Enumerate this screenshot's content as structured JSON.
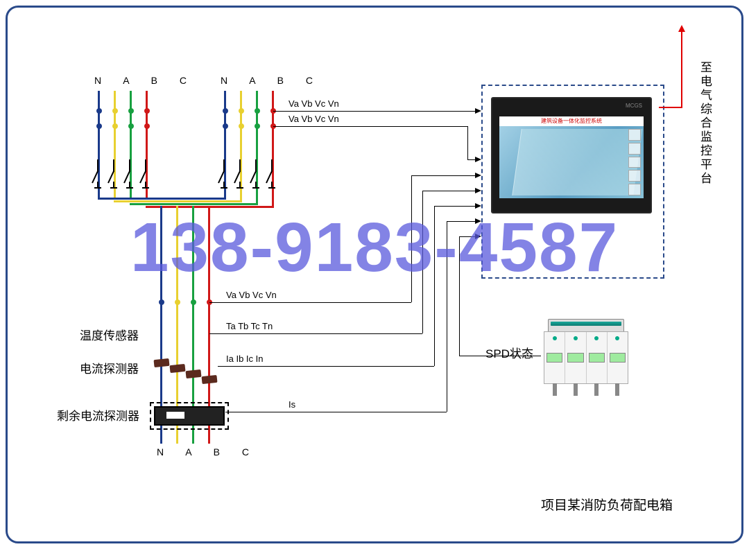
{
  "phase_labels": {
    "top1": "N  A  B  C",
    "top2": "N  A  B  C",
    "bottom": "N  A  B  C"
  },
  "phase_colors": {
    "N": "#1a3a8a",
    "A": "#e8d030",
    "B": "#18a040",
    "C": "#d01818"
  },
  "signals": {
    "v_row1": "Va  Vb  Vc  Vn",
    "v_row2": "Va  Vb  Vc  Vn",
    "v_row3": "Va  Vb  Vc  Vn",
    "t_row": "Ta  Tb  Tc  Tn",
    "i_row": "Ia   Ib   Ic   In",
    "is_row": "Is"
  },
  "sensor_labels": {
    "temp": "温度传感器",
    "current": "电流探测器",
    "residual": "剩余电流探测器"
  },
  "spd_label": "SPD状态",
  "platform_label": "至电气综合监控平台",
  "title": "项目某消防负荷配电箱",
  "watermark": "138-9183-4587",
  "monitor": {
    "brand": "MCGS",
    "header": "建筑设备一体化监控系统"
  }
}
